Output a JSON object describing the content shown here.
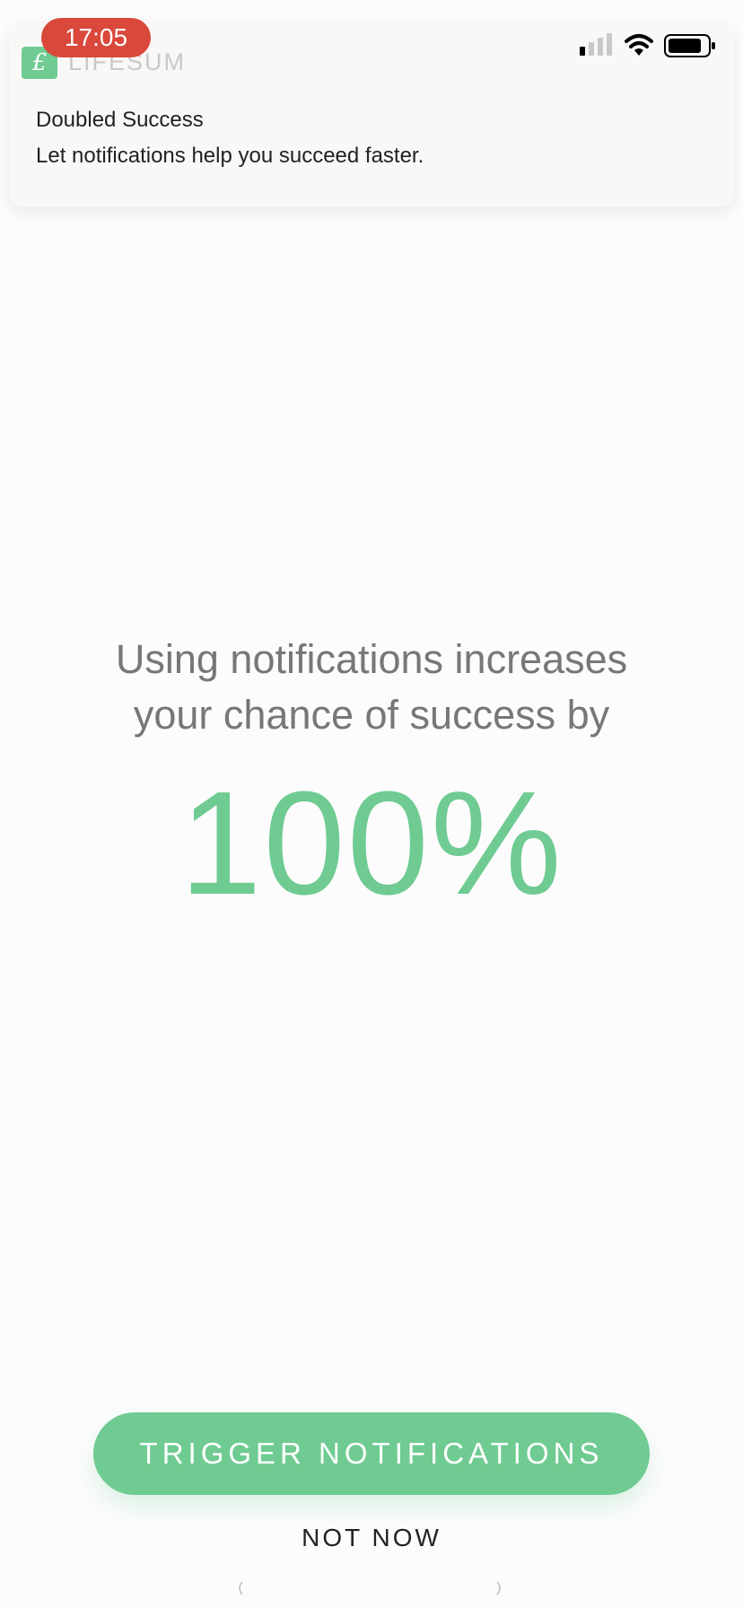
{
  "status_bar": {
    "time": "17:05",
    "icons": [
      "cellular-signal-icon",
      "wifi-icon",
      "battery-icon"
    ]
  },
  "notification": {
    "app_name": "LIFESUM",
    "app_icon_glyph": "£",
    "title": "Doubled Success",
    "body": "Let notifications help you succeed faster."
  },
  "main": {
    "headline_line1": "Using notifications increases",
    "headline_line2": "your chance of success by",
    "percent": "100%"
  },
  "actions": {
    "primary_label": "TRIGGER NOTIFICATIONS",
    "secondary_label": "NOT NOW"
  },
  "colors": {
    "accent": "#6fcb92",
    "time_pill": "#d9483b",
    "text_gray": "#777777"
  }
}
